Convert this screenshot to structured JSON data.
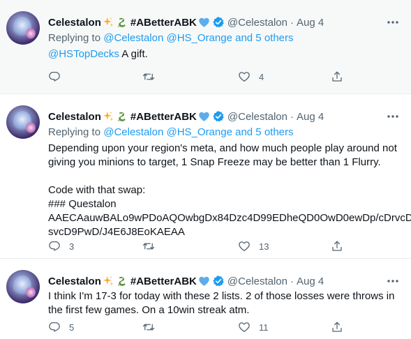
{
  "tweets": [
    {
      "name": "Celestalon",
      "hashtag": "#ABetterABK",
      "handle": "@Celestalon",
      "date": "Aug 4",
      "separator": "·",
      "replying_prefix": "Replying to",
      "replying_links": "@Celestalon @HS_Orange",
      "replying_others": "and 5 others",
      "text_mention": "@HSTopDecks",
      "text": " A gift.",
      "reply_count": "",
      "retweet_count": "",
      "like_count": "4"
    },
    {
      "name": "Celestalon",
      "hashtag": "#ABetterABK",
      "handle": "@Celestalon",
      "date": "Aug 4",
      "separator": "·",
      "replying_prefix": "Replying to",
      "replying_links": "@Celestalon @HS_Orange",
      "replying_others": "and 5 others",
      "text": "Depending upon your region's meta, and how much people play around not\ngiving you minions to target, 1 Snap Freeze may be better than 1 Flurry.\n\nCode with that swap:\n### Questalon\nAAECAauwBALo9wPDoAQOwbgDx84Dzc4D99EDheQD0OwD0ewDp/cDrvcD\nsvcD9PwD/J4E6J8EoKAEAA",
      "reply_count": "3",
      "retweet_count": "",
      "like_count": "13"
    },
    {
      "name": "Celestalon",
      "hashtag": "#ABetterABK",
      "handle": "@Celestalon",
      "date": "Aug 4",
      "separator": "·",
      "text": "I think I'm 17-3 for today with these 2 lists. 2 of those losses were throws in\nthe first few games. On a 10win streak atm.",
      "reply_count": "5",
      "retweet_count": "",
      "like_count": "11"
    }
  ],
  "icons": {
    "more": "more-icon",
    "reply": "reply-icon",
    "retweet": "retweet-icon",
    "like": "like-icon",
    "share": "share-icon",
    "verified": "verified-icon",
    "sparkles": "sparkles-emoji",
    "dragon": "dragon-emoji",
    "blue_heart": "blue-heart-emoji"
  },
  "colors": {
    "link": "#1d9bf0",
    "muted": "#536471",
    "text": "#0f1419",
    "highlight_bg": "#f7f9f9"
  }
}
